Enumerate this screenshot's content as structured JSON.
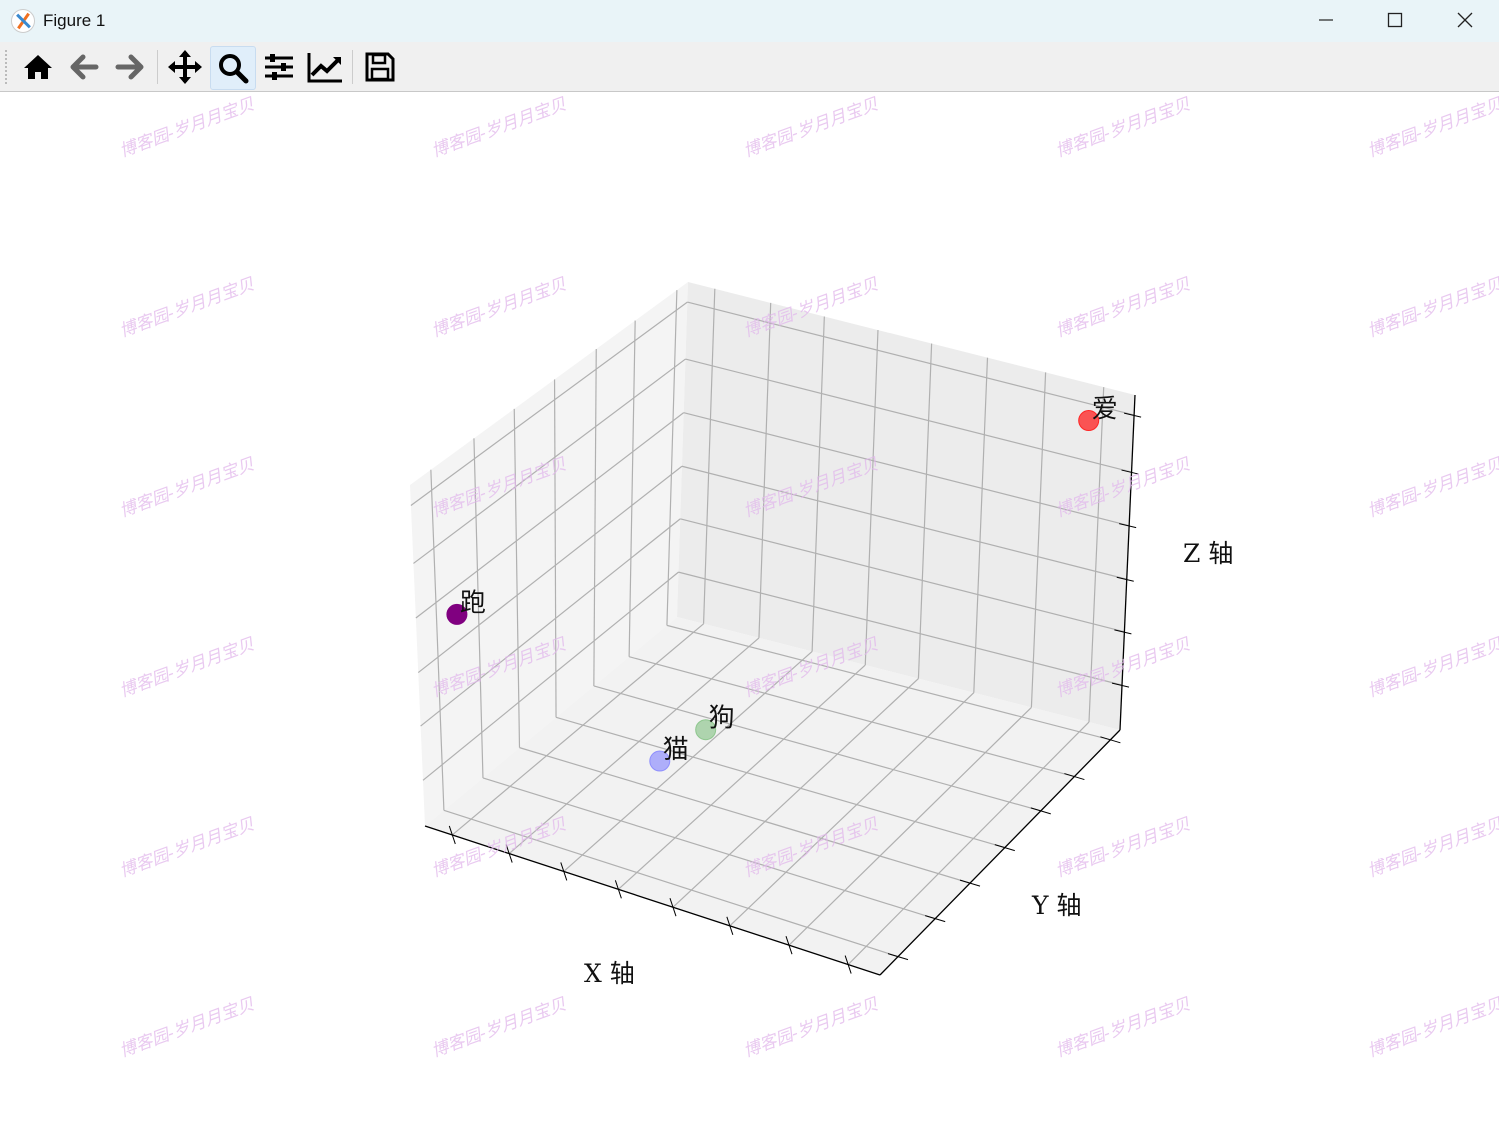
{
  "window": {
    "title": "Figure 1"
  },
  "toolbar": {
    "buttons": [
      {
        "name": "home",
        "icon": "home-icon"
      },
      {
        "name": "back",
        "icon": "arrow-left-icon"
      },
      {
        "name": "forward",
        "icon": "arrow-right-icon"
      },
      {
        "name": "pan",
        "icon": "move-icon"
      },
      {
        "name": "zoom",
        "icon": "magnifier-icon",
        "active": true
      },
      {
        "name": "subplots",
        "icon": "sliders-icon"
      },
      {
        "name": "customize",
        "icon": "line-chart-icon"
      },
      {
        "name": "save",
        "icon": "floppy-disk-icon"
      }
    ]
  },
  "watermark": "博客园-岁月月宝贝",
  "chart_data": {
    "type": "scatter",
    "projection": "3d",
    "xlabel": "X 轴",
    "ylabel": "Y 轴",
    "zlabel": "Z 轴",
    "xlim": [
      0,
      1
    ],
    "ylim": [
      0,
      1
    ],
    "zlim": [
      0,
      1
    ],
    "grid": true,
    "tick_labels_visible": false,
    "points": [
      {
        "label": "跑",
        "x": 0.0,
        "y": 0.15,
        "z": 0.53,
        "color": "#800080",
        "alpha": 1.0
      },
      {
        "label": "猫",
        "x": 0.27,
        "y": 0.45,
        "z": 0.02,
        "color": "#8080ff",
        "alpha": 0.6
      },
      {
        "label": "狗",
        "x": 0.3,
        "y": 0.58,
        "z": 0.04,
        "color": "#80c080",
        "alpha": 0.6
      },
      {
        "label": "爱",
        "x": 0.9,
        "y": 1.0,
        "z": 0.89,
        "color": "#ff2020",
        "alpha": 0.75
      }
    ]
  }
}
